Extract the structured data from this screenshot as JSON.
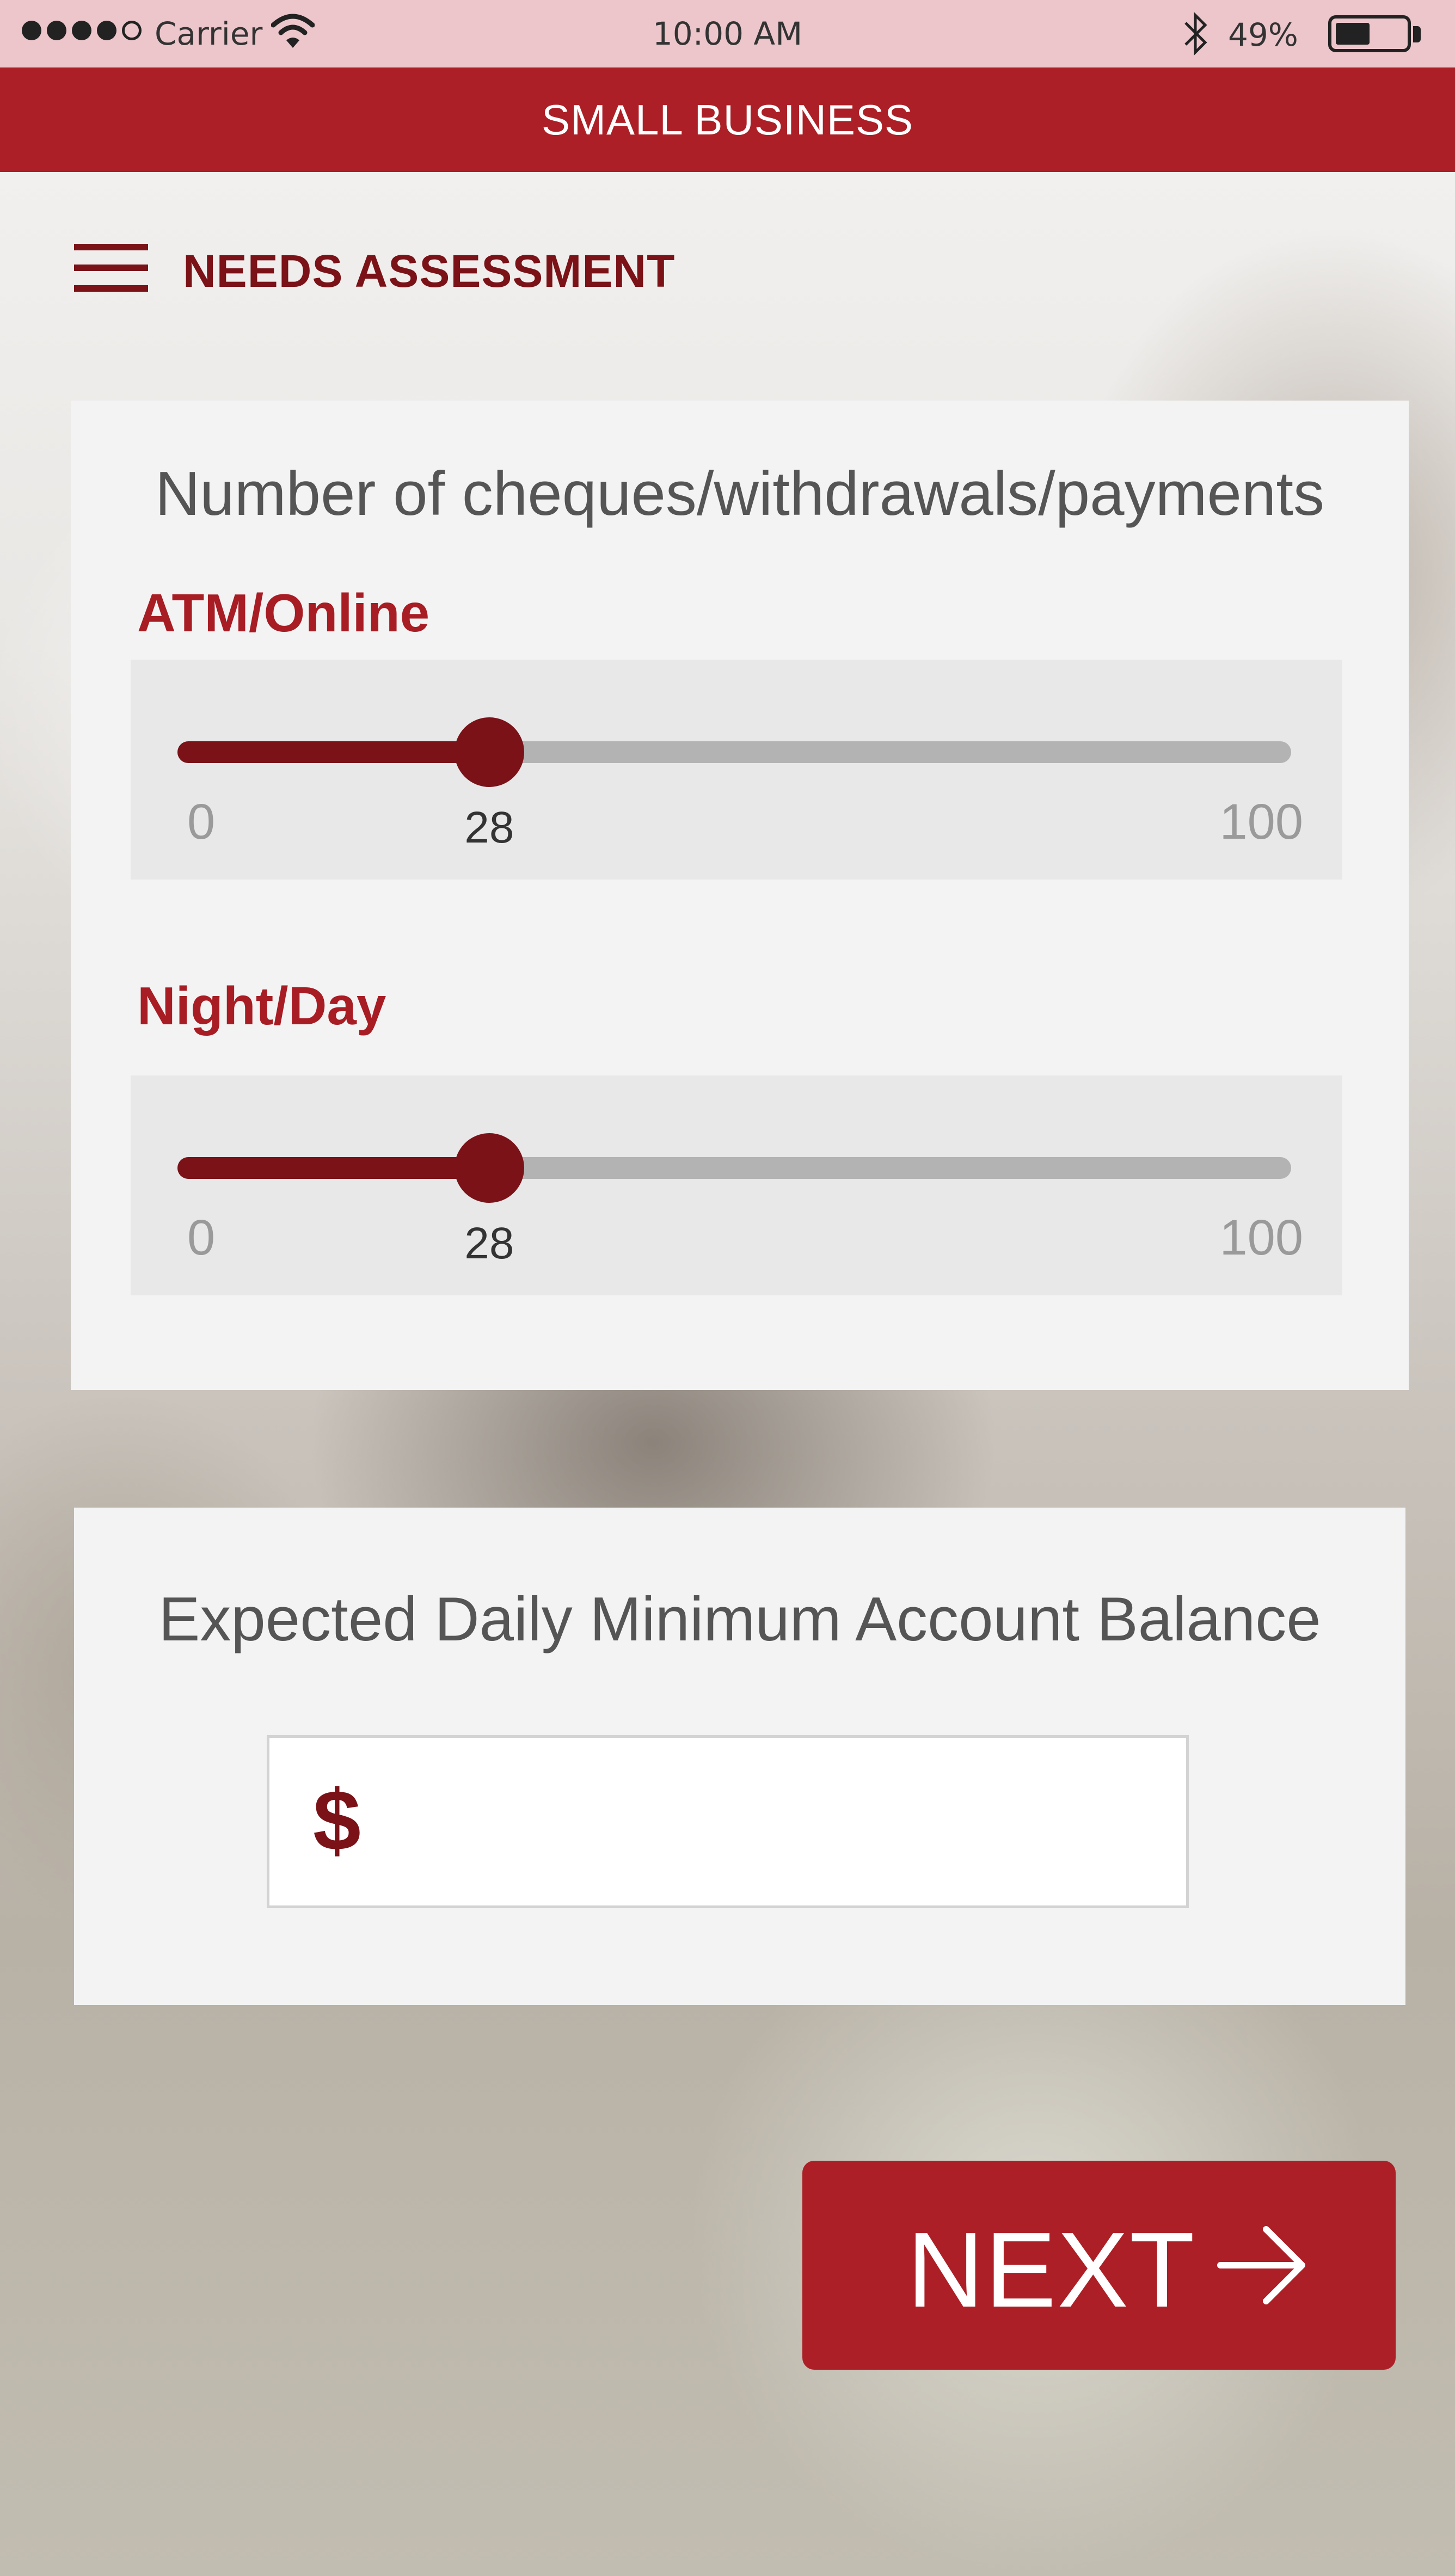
{
  "status_bar": {
    "carrier": "Carrier",
    "time": "10:00 AM",
    "battery": "49%",
    "signal_bars_filled": 4,
    "signal_bars_total": 5,
    "battery_level": 0.49
  },
  "app_bar": {
    "title": "SMALL BUSINESS"
  },
  "header": {
    "title": "NEEDS ASSESSMENT",
    "menu_icon": "hamburger-menu-icon"
  },
  "transactions_card": {
    "heading": "Number of cheques/withdrawals/payments",
    "sliders": [
      {
        "label": "ATM/Online",
        "min": "0",
        "max": "100",
        "value": "28"
      },
      {
        "label": "Night/Day",
        "min": "0",
        "max": "100",
        "value": "28"
      }
    ]
  },
  "balance_card": {
    "heading": "Expected Daily Minimum Account Balance",
    "currency_symbol": "$",
    "value": "",
    "placeholder": ""
  },
  "next_button": {
    "label": "NEXT",
    "icon": "arrow-right-icon"
  },
  "colors": {
    "brand_red": "#ad1f26",
    "dark_red": "#7a1218",
    "status_bar_pink": "#ecc6cb",
    "card_bg": "#f3f3f3"
  }
}
